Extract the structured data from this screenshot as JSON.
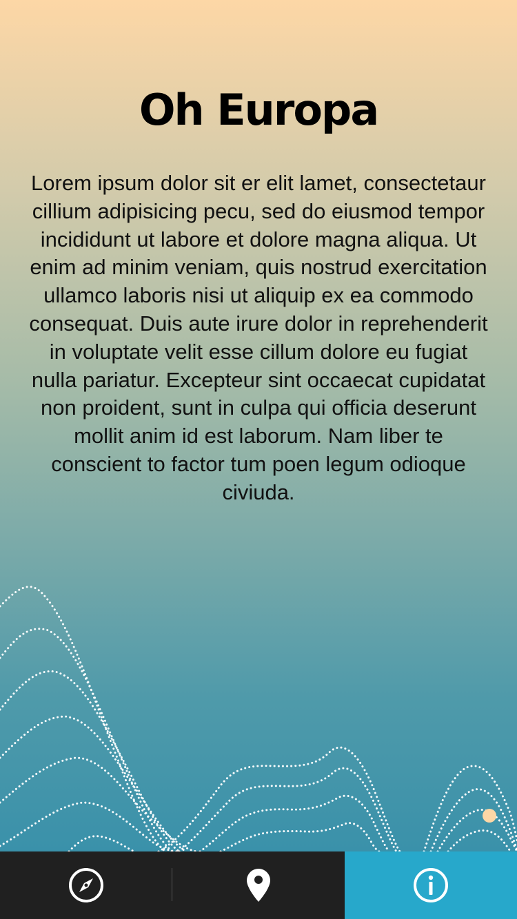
{
  "page": {
    "title": "Oh Europa",
    "body": "Lorem ipsum dolor sit er elit lamet, consectetaur cillium adipisicing pecu, sed do eiusmod tempor incididunt ut labore et dolore magna aliqua. Ut enim ad minim veniam, quis nostrud exercitation ullamco laboris nisi ut aliquip ex ea commodo consequat. Duis aute irure dolor in reprehenderit in voluptate velit esse cillum dolore eu fugiat nulla pariatur. Excepteur sint occaecat cupidatat non proident, sunt in culpa qui officia deserunt mollit anim id est laborum. Nam liber te conscient to factor tum poen legum odioque civiuda."
  },
  "tabbar": {
    "tabs": [
      {
        "icon": "compass-icon",
        "active": false
      },
      {
        "icon": "location-pin-icon",
        "active": false
      },
      {
        "icon": "info-icon",
        "active": true
      }
    ]
  },
  "colors": {
    "gradient_top": "#fdd7a6",
    "gradient_bottom": "#3a91aa",
    "tabbar_bg": "#202020",
    "tab_active_bg": "#27a8cb",
    "accent_dot": "#fdd7a6"
  }
}
